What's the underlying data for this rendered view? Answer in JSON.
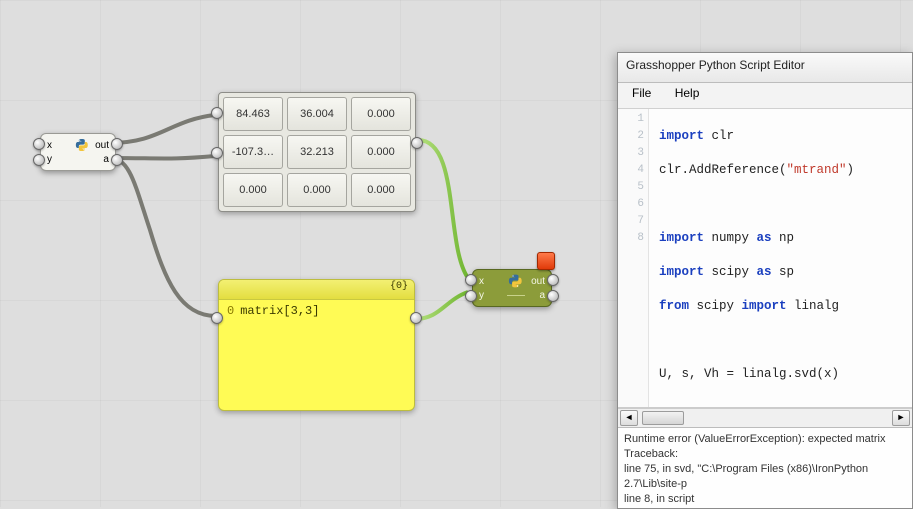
{
  "canvas": {
    "node1": {
      "inputs": [
        "x",
        "y"
      ],
      "outputs": [
        "out",
        "a"
      ]
    },
    "node2": {
      "inputs": [
        "x",
        "y"
      ],
      "outputs": [
        "out",
        "a"
      ]
    },
    "matrix": {
      "rows": [
        [
          "84.463",
          "36.004",
          "0.000"
        ],
        [
          "-107.3…",
          "32.213",
          "0.000"
        ],
        [
          "0.000",
          "0.000",
          "0.000"
        ]
      ]
    },
    "textpanel": {
      "header": "{0}",
      "idx": "0",
      "text": "matrix[3,3]"
    }
  },
  "editor": {
    "title": "Grasshopper Python Script Editor",
    "menu": {
      "file": "File",
      "help": "Help"
    },
    "gutter": [
      "1",
      "2",
      "3",
      "4",
      "5",
      "6",
      "7",
      "8"
    ],
    "code": {
      "l1": {
        "kw": "import",
        "rest": " clr"
      },
      "l2": {
        "pre": "clr.AddReference(",
        "str": "\"mtrand\"",
        "post": ")"
      },
      "l3": "",
      "l4": {
        "kw1": "import",
        "mid": " numpy ",
        "kw2": "as",
        "rest": " np"
      },
      "l5": {
        "kw1": "import",
        "mid": " scipy ",
        "kw2": "as",
        "rest": " sp"
      },
      "l6": {
        "kw1": "from",
        "mid": " scipy ",
        "kw2": "import",
        "rest": " linalg"
      },
      "l7": "",
      "l8": "U, s, Vh = linalg.svd(x)"
    },
    "error": {
      "l1": "Runtime error (ValueErrorException): expected matrix",
      "l2": "Traceback:",
      "l3": "  line 75, in svd, \"C:\\Program Files (x86)\\IronPython 2.7\\Lib\\site-p",
      "l4": "  line 8, in script"
    }
  }
}
